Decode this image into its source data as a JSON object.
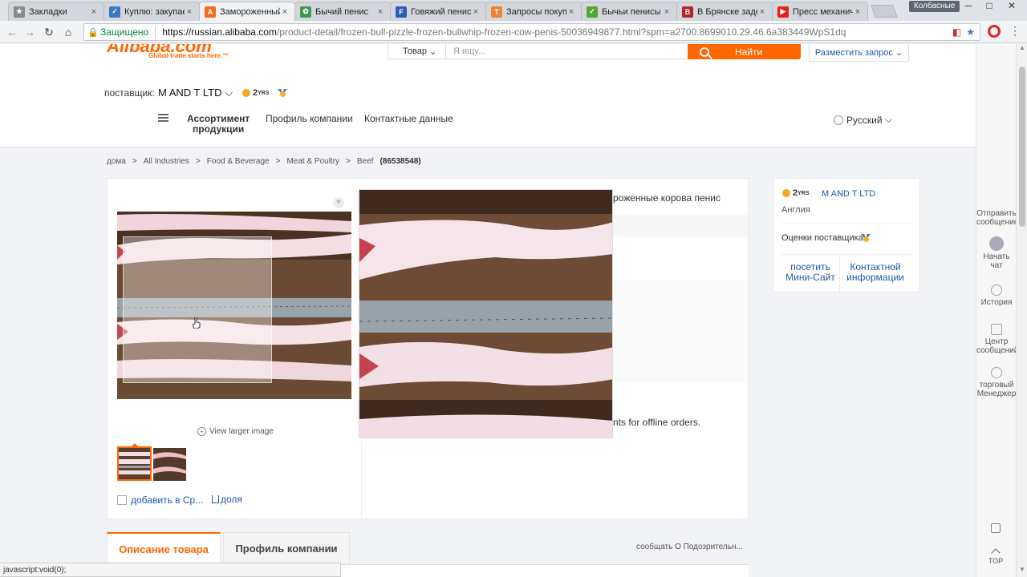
{
  "browser": {
    "tabs": [
      {
        "title": "Закладки",
        "icon": "star-icon",
        "color": "#888888",
        "glyph": "★"
      },
      {
        "title": "Куплю: закупаем",
        "icon": "check-box-icon",
        "color": "#3a77c8",
        "glyph": "✓"
      },
      {
        "title": "Замороженный",
        "icon": "alibaba-icon",
        "color": "#f06e1e",
        "glyph": "A"
      },
      {
        "title": "Бычий пенис",
        "icon": "leaf-icon",
        "color": "#3c9a4a",
        "glyph": "✿"
      },
      {
        "title": "Говяжий пенис",
        "icon": "f-icon",
        "color": "#2a5cb8",
        "glyph": "F"
      },
      {
        "title": "Запросы покупателей",
        "icon": "t-icon",
        "color": "#f0833a",
        "glyph": "T"
      },
      {
        "title": "Бычьи пенисы",
        "icon": "check-green-icon",
        "color": "#55a630",
        "glyph": "✓"
      },
      {
        "title": "В Брянске задержали",
        "icon": "b-icon",
        "color": "#b5232b",
        "glyph": "B"
      },
      {
        "title": "Пресс механический",
        "icon": "youtube-icon",
        "color": "#e62117",
        "glyph": "▶"
      }
    ],
    "active_tab_index": 2,
    "close_glyph": "×",
    "profile_name": "Колбасные",
    "window_controls": [
      "─",
      "□",
      "✕"
    ],
    "address": {
      "secure_label": "Защищено",
      "url_host": "https://russian.alibaba.com",
      "url_path": "/product-detail/frozen-bull-pizzle-frozen-bullwhip-frozen-cow-penis-50036949877.html?spm=a2700.8699010.29.46.6a383449WpS1dq"
    },
    "status_text": "javascript:void(0);"
  },
  "header": {
    "logo_text": "Alibaba.com",
    "logo_tagline": "Global trade starts here.™",
    "search_category": "Товар",
    "search_placeholder": "Я ищу...",
    "search_button": "Найти",
    "rfq_button": "Разместить запрос"
  },
  "supplier_bar": {
    "label": "поставщик:",
    "name": "M AND T LTD",
    "years": "2",
    "years_suffix": "YRS",
    "nav": {
      "products_line1": "Ассортимент",
      "products_line2": "продукции",
      "profile": "Профиль компании",
      "contacts": "Контактные данные"
    },
    "language": "Русский"
  },
  "breadcrumb": {
    "items": [
      "дома",
      "All Industries",
      "Food & Beverage",
      "Meat & Poultry",
      "Beef"
    ],
    "separator": ">",
    "count": "(86538548)"
  },
  "product": {
    "title_fragment": "роженные корова пенис",
    "offline_fragment": "nts for offline orders.",
    "view_larger": "View larger image",
    "compare": "добавить в Ср...",
    "share": "доля"
  },
  "supplier_card": {
    "years": "2",
    "years_suffix": "YRS",
    "company": "M AND T LTD",
    "country": "Англия",
    "rating_label": "Оценки поставщика:",
    "visit_line1": "посетить",
    "visit_line2": "Мини-Сайт",
    "contact_line1": "Контактной",
    "contact_line2": "информации"
  },
  "right_rail": {
    "send_line1": "Отправить",
    "send_line2": "сообщение",
    "chat_line1": "Начать",
    "chat_line2": "чат",
    "history": "История",
    "center_line1": "Центр",
    "center_line2": "сообщений",
    "manager_line1": "торговый",
    "manager_line2": "Менеджер",
    "top": "TOP"
  },
  "bottom_tabs": {
    "description": "Описание товара",
    "company_profile": "Профиль компании",
    "report": "сообщать О Подозрительн..."
  }
}
